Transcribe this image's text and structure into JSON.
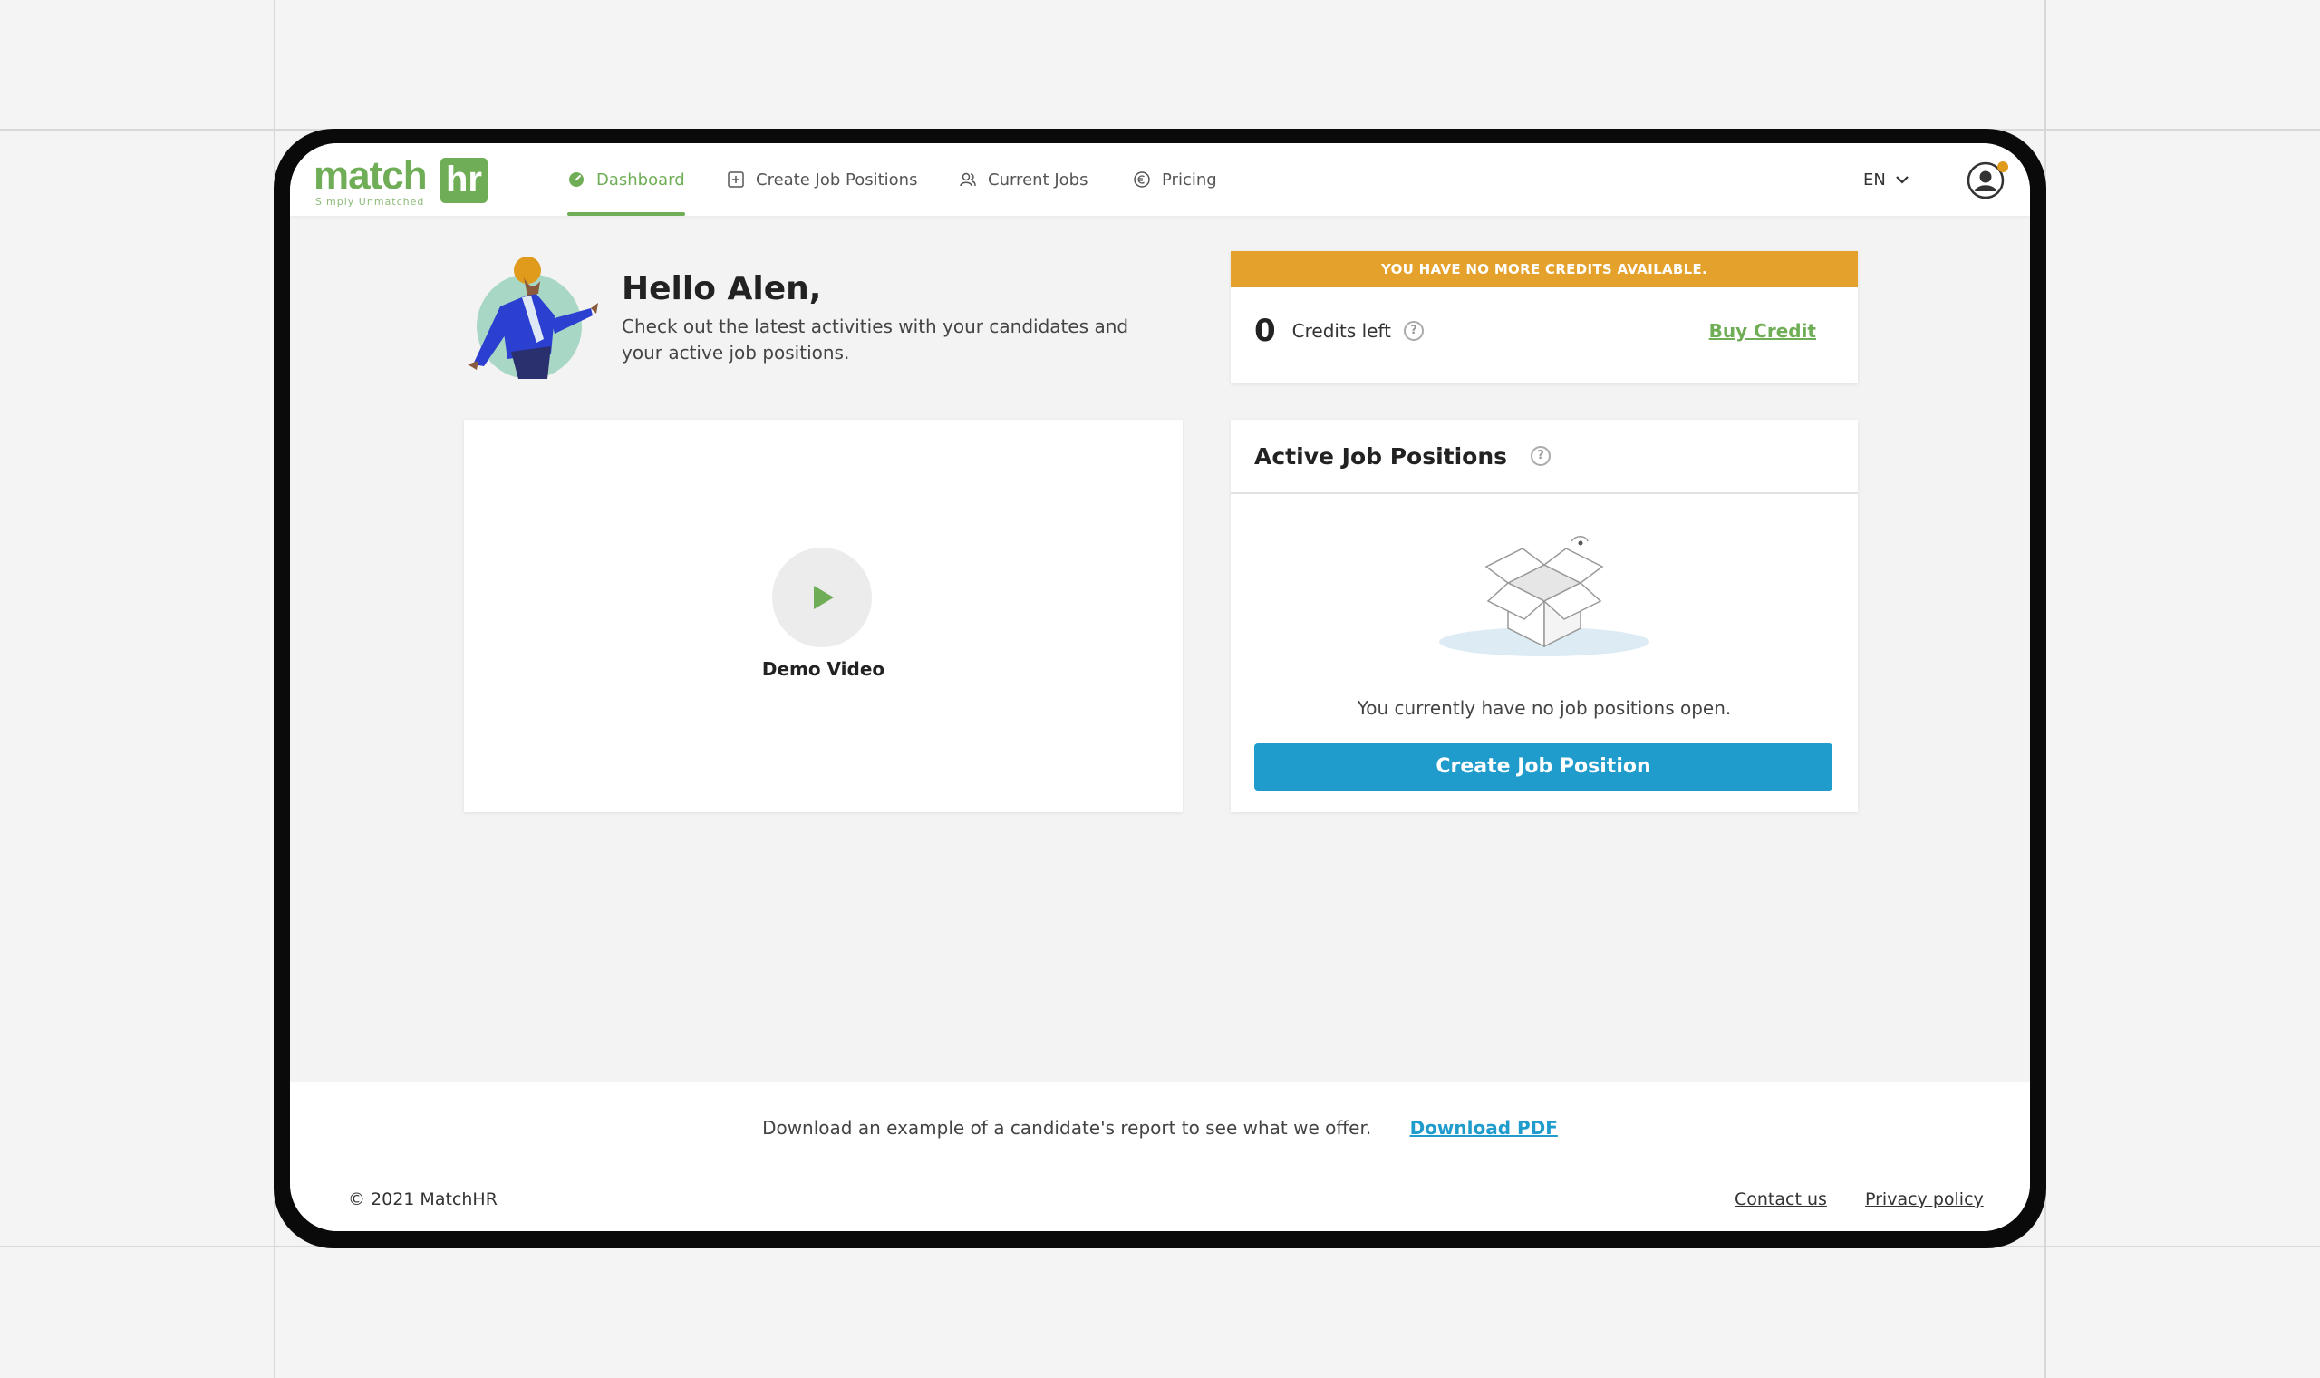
{
  "brand": {
    "wordmark": "match",
    "box": "hr",
    "tagline": "Simply Unmatched"
  },
  "nav": {
    "items": [
      {
        "label": "Dashboard",
        "icon": "dashboard-icon"
      },
      {
        "label": "Create Job Positions",
        "icon": "plus-square-icon"
      },
      {
        "label": "Current Jobs",
        "icon": "users-icon"
      },
      {
        "label": "Pricing",
        "icon": "euro-icon"
      }
    ],
    "language": "EN"
  },
  "greeting": {
    "title": "Hello Alen,",
    "subtitle": "Check out the latest activities with your candidates and your active job positions."
  },
  "credits": {
    "banner": "YOU HAVE NO MORE CREDITS AVAILABLE.",
    "count": "0",
    "label": "Credits left",
    "buy_label": "Buy Credit"
  },
  "video": {
    "label": "Demo Video"
  },
  "jobs": {
    "title": "Active Job Positions",
    "empty_text": "You currently have no job positions open.",
    "create_label": "Create Job Position"
  },
  "footer": {
    "message": "Download an example of a candidate's report to see what we offer.",
    "download_label": "Download PDF",
    "copyright": "© 2021 MatchHR",
    "contact_label": "Contact us",
    "privacy_label": "Privacy policy"
  },
  "colors": {
    "brand_green": "#6fae57",
    "warning_orange": "#e4a12b",
    "action_blue": "#1f9ccc",
    "notification_dot": "#e09a1c"
  }
}
